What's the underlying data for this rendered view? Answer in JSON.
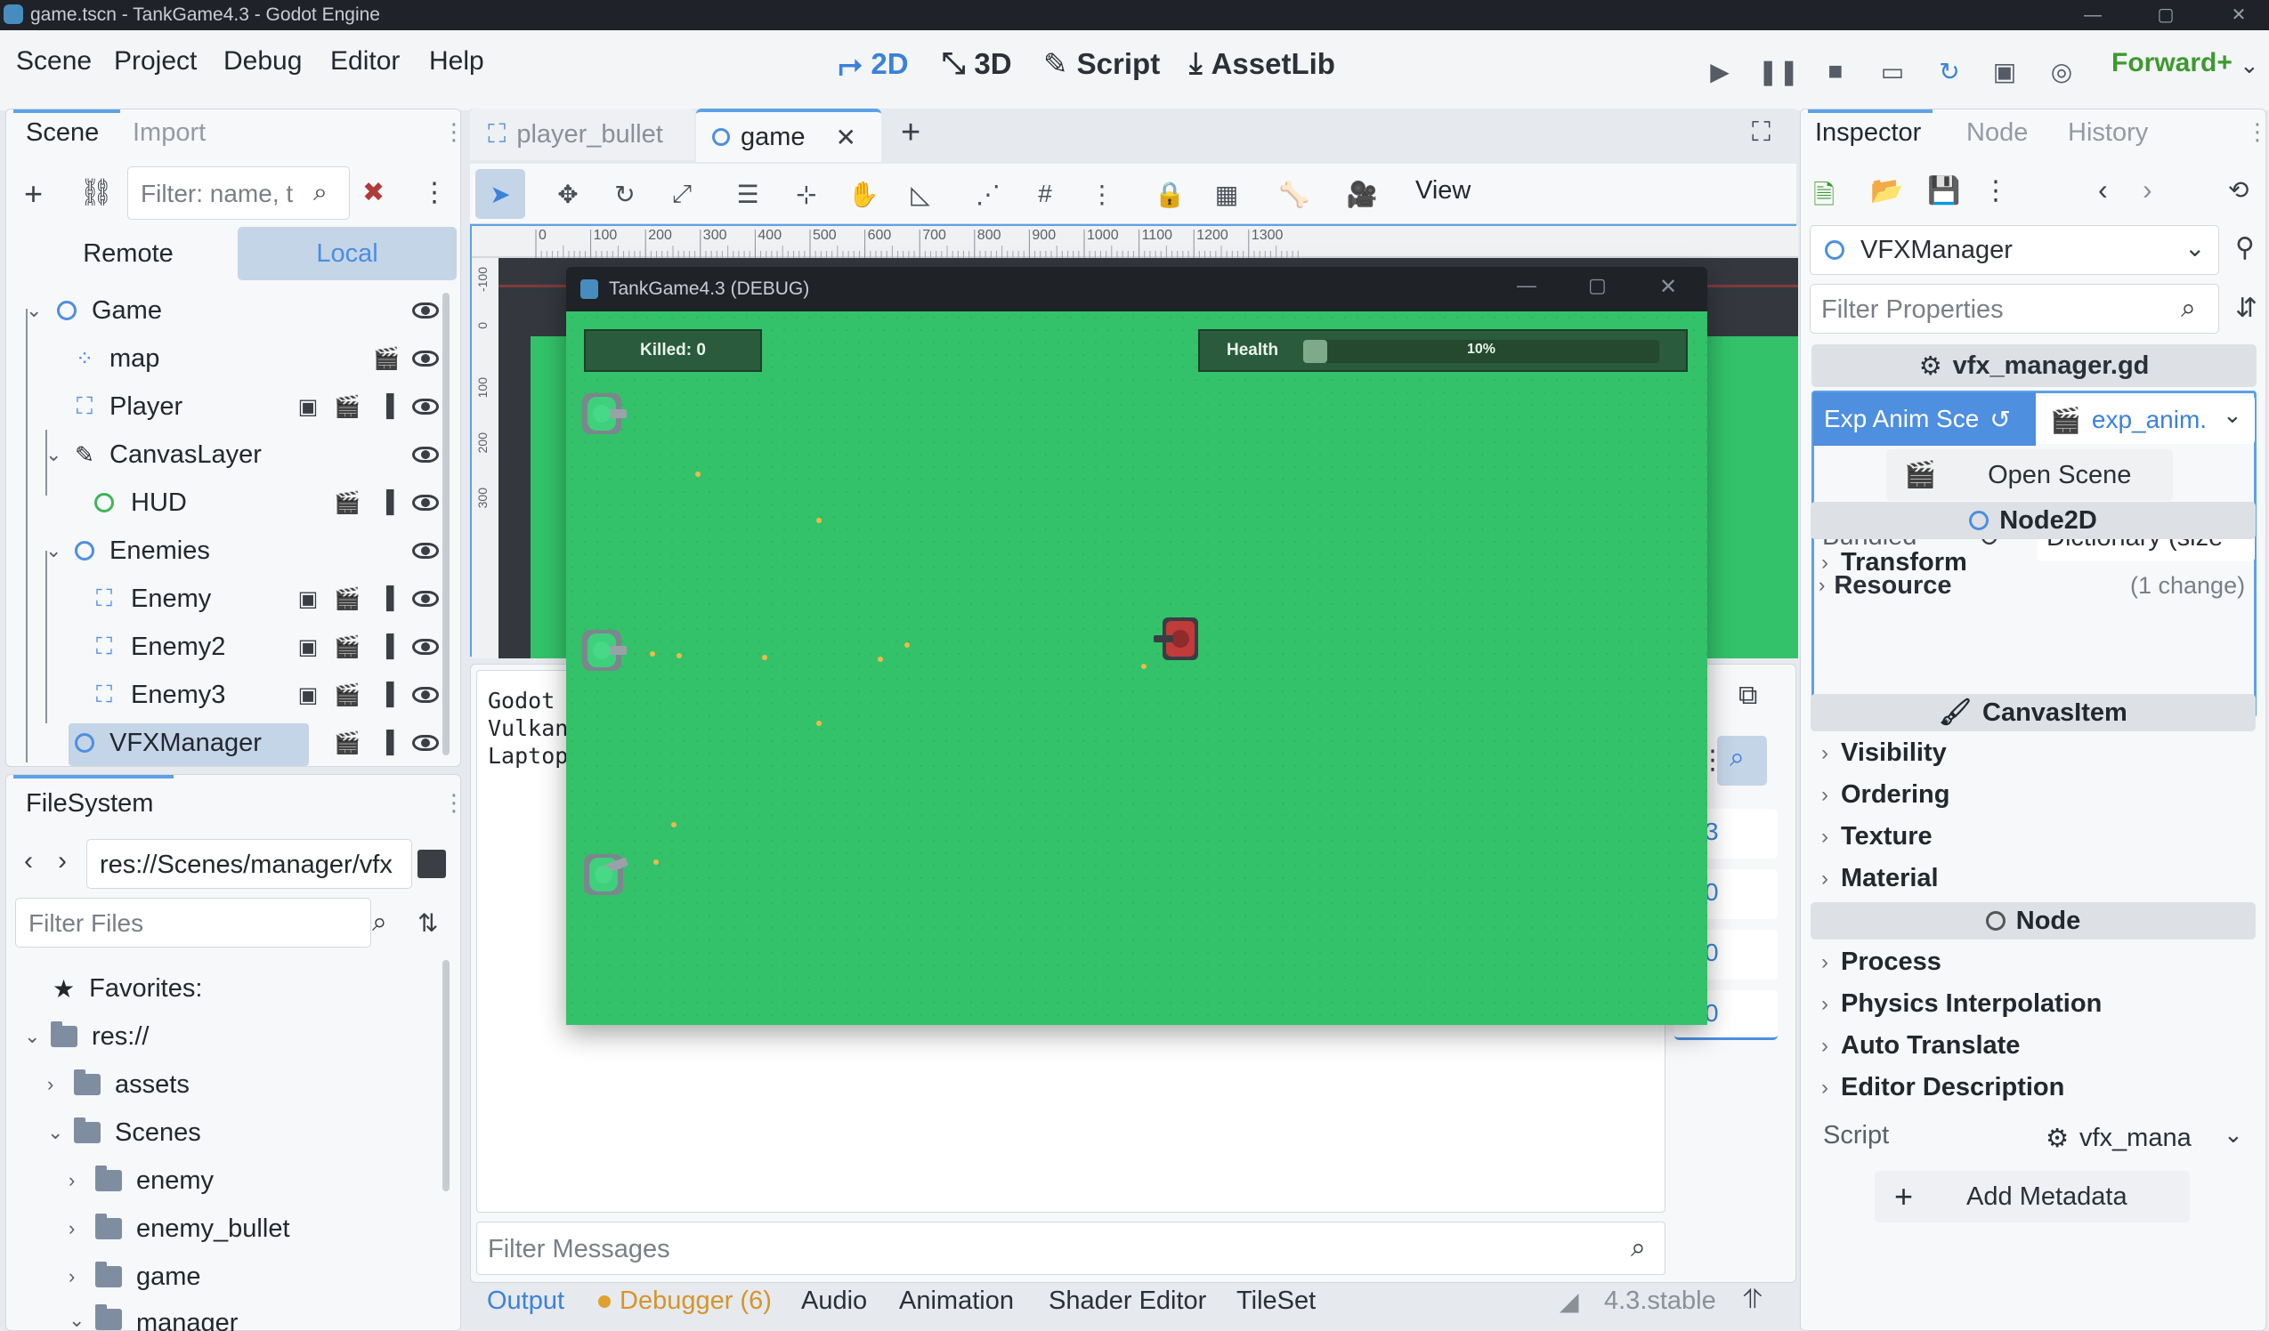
{
  "window": {
    "title": "game.tscn - TankGame4.3 - Godot Engine"
  },
  "menu": [
    "Scene",
    "Project",
    "Debug",
    "Editor",
    "Help"
  ],
  "workspaces": {
    "2d": "2D",
    "3d": "3D",
    "script": "Script",
    "assetlib": "AssetLib"
  },
  "renderer": "Forward+",
  "scene_dock": {
    "tabs": [
      "Scene",
      "Import"
    ],
    "filter_placeholder": "Filter: name, t",
    "remote": "Remote",
    "local": "Local",
    "nodes": [
      {
        "name": "Game",
        "type": "Node2D"
      },
      {
        "name": "map",
        "type": "TileMap"
      },
      {
        "name": "Player",
        "type": "CharacterBody2D"
      },
      {
        "name": "CanvasLayer",
        "type": "CanvasLayer"
      },
      {
        "name": "HUD",
        "type": "Control"
      },
      {
        "name": "Enemies",
        "type": "Node2D"
      },
      {
        "name": "Enemy",
        "type": "CharacterBody2D"
      },
      {
        "name": "Enemy2",
        "type": "CharacterBody2D"
      },
      {
        "name": "Enemy3",
        "type": "CharacterBody2D"
      },
      {
        "name": "VFXManager",
        "type": "Node2D"
      }
    ]
  },
  "filesystem": {
    "tab": "FileSystem",
    "path": "res://Scenes/manager/vfx",
    "filter_placeholder": "Filter Files",
    "favorites": "Favorites:",
    "items": [
      "res://",
      "assets",
      "Scenes",
      "enemy",
      "enemy_bullet",
      "game",
      "manager"
    ]
  },
  "scene_tabs": {
    "tab1": "player_bullet",
    "tab2": "game"
  },
  "toolbar": {
    "view": "View"
  },
  "ruler_ticks": [
    "0",
    "100",
    "200",
    "300",
    "400",
    "500",
    "600",
    "700",
    "800",
    "900",
    "1000",
    "1100",
    "1200",
    "1300"
  ],
  "vruler_ticks": [
    "-100",
    "0",
    "100",
    "200",
    "300"
  ],
  "game_window": {
    "title": "TankGame4.3 (DEBUG)",
    "killed_label": "Killed: 0",
    "health_label": "Health",
    "health_text": "10%",
    "health_value": 0.1
  },
  "output": {
    "lines": [
      "Godot",
      "Vulkan",
      "Laptop"
    ],
    "filter_placeholder": "Filter Messages",
    "counts": [
      "3",
      "0",
      "0",
      "0"
    ]
  },
  "bottom_tabs": {
    "output": "Output",
    "debugger": "Debugger (6)",
    "audio": "Audio",
    "animation": "Animation",
    "shader": "Shader Editor",
    "tileset": "TileSet"
  },
  "version": "4.3.stable",
  "inspector": {
    "tabs": [
      "Inspector",
      "Node",
      "History"
    ],
    "object": "VFXManager",
    "filter_placeholder": "Filter Properties",
    "script_header": "vfx_manager.gd",
    "exp_anim_label": "Exp Anim Sce",
    "exp_anim_value": "exp_anim.",
    "open_scene": "Open Scene",
    "bundled_label": "Bundled",
    "bundled_value": "Dictionary (size",
    "resource_label": "Resource",
    "resource_changes": "(1 change)",
    "node2d": "Node2D",
    "transform": "Transform",
    "canvasitem": "CanvasItem",
    "visibility": "Visibility",
    "ordering": "Ordering",
    "texture": "Texture",
    "material": "Material",
    "node": "Node",
    "process": "Process",
    "physics_interp": "Physics Interpolation",
    "auto_translate": "Auto Translate",
    "editor_desc": "Editor Description",
    "script_label": "Script",
    "script_value": "vfx_mana",
    "add_metadata": "Add Metadata"
  },
  "colors": {
    "accent": "#3b82d9",
    "field": "#33c26a",
    "renderer": "#3d9a2f",
    "debugger": "#e0a030"
  }
}
